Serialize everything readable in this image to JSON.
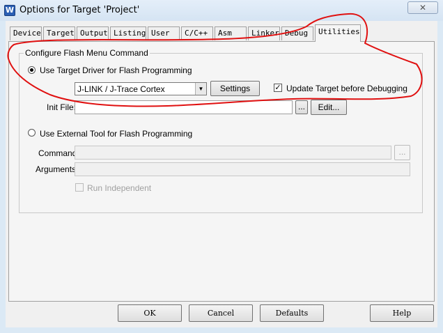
{
  "window": {
    "title": "Options for Target 'Project'",
    "app_icon_glyph": "W",
    "close_glyph": "✕"
  },
  "tabs": [
    "Device",
    "Target",
    "Output",
    "Listing",
    "User",
    "C/C++",
    "Asm",
    "Linker",
    "Debug",
    "Utilities"
  ],
  "active_tab": "Utilities",
  "group": {
    "title": "Configure Flash Menu Command",
    "use_target_driver": {
      "label": "Use Target Driver for Flash Programming",
      "checked": true
    },
    "driver_select": {
      "value": "J-LINK / J-Trace Cortex",
      "arrow": "▼"
    },
    "settings_label": "Settings",
    "update_target": {
      "label": "Update Target before Debugging",
      "checked": true,
      "mark": "✓"
    },
    "init_file": {
      "label": "Init File:",
      "value": "",
      "browse_label": "...",
      "edit_label": "Edit..."
    },
    "use_external_tool": {
      "label": "Use External Tool for Flash Programming",
      "checked": false
    },
    "command": {
      "label": "Command:",
      "value": "",
      "browse_label": "..."
    },
    "arguments": {
      "label": "Arguments:",
      "value": ""
    },
    "run_independent": {
      "label": "Run Independent",
      "checked": false
    }
  },
  "buttons": {
    "ok": "OK",
    "cancel": "Cancel",
    "defaults": "Defaults",
    "help": "Help"
  },
  "colors": {
    "annotation": "#e01010",
    "title_bg": "#dbe9f5",
    "dialog_bg": "#f0f0f0"
  }
}
